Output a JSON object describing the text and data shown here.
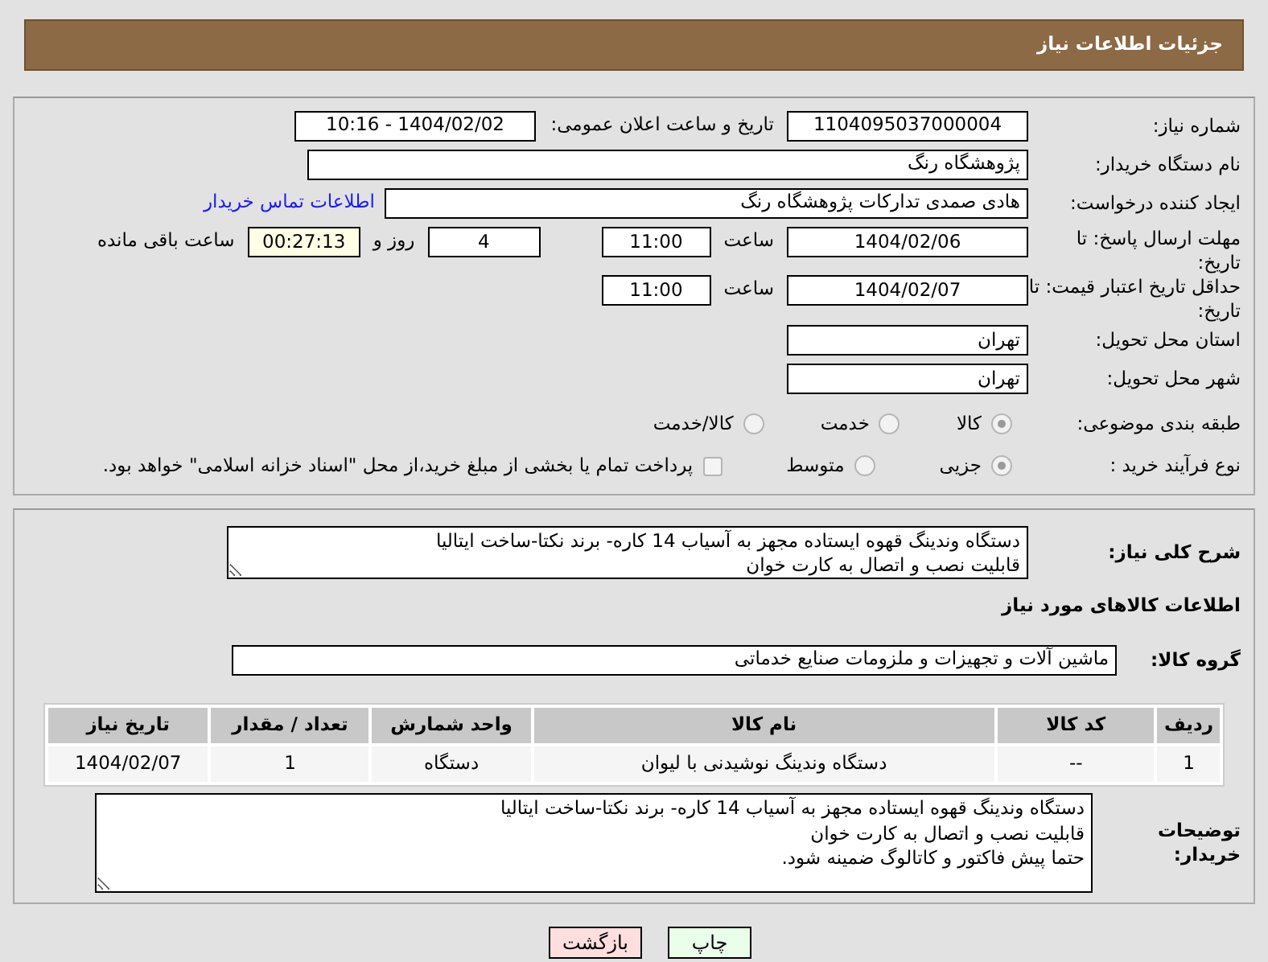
{
  "header": {
    "title": "جزئیات اطلاعات نیاز"
  },
  "need_number": {
    "label": "شماره نیاز:",
    "value": "1104095037000004"
  },
  "announce": {
    "label": "تاریخ و ساعت اعلان عمومی:",
    "value": "1404/02/02 - 10:16"
  },
  "buyer_org": {
    "label": "نام دستگاه خریدار:",
    "value": "پژوهشگاه رنگ"
  },
  "requester": {
    "label": "ایجاد کننده درخواست:",
    "value": "هادی صمدی تدارکات پژوهشگاه رنگ",
    "contact_link": "اطلاعات تماس خریدار"
  },
  "reply_deadline": {
    "label": "مهلت ارسال پاسخ: تا تاریخ:",
    "date": "1404/02/06",
    "time_label": "ساعت",
    "time": "11:00",
    "days": "4",
    "days_label": "روز و",
    "remaining": "00:27:13",
    "remaining_label": "ساعت باقی مانده"
  },
  "price_validity": {
    "label": "حداقل تاریخ اعتبار قیمت: تا تاریخ:",
    "date": "1404/02/07",
    "time_label": "ساعت",
    "time": "11:00"
  },
  "province": {
    "label": "استان محل تحویل:",
    "value": "تهران"
  },
  "city": {
    "label": "شهر محل تحویل:",
    "value": "تهران"
  },
  "category": {
    "label": "طبقه بندی موضوعی:",
    "options": [
      {
        "label": "کالا",
        "selected": true
      },
      {
        "label": "خدمت",
        "selected": false
      },
      {
        "label": "کالا/خدمت",
        "selected": false
      }
    ]
  },
  "purchase_type": {
    "label": "نوع فرآیند خرید :",
    "options": [
      {
        "label": "جزیی",
        "selected": true
      },
      {
        "label": "متوسط",
        "selected": false
      }
    ],
    "payment_note": {
      "text": "پرداخت تمام یا بخشی از مبلغ خرید،از محل \"اسناد خزانه اسلامی\" خواهد بود.",
      "checked": false
    }
  },
  "description": {
    "label": "شرح کلی نیاز:",
    "lines": [
      "دستگاه وندینگ قهوه ایستاده مجهز به آسیاب 14 کاره- برند نکتا-ساخت ایتالیا",
      "قابلیت نصب و اتصال به کارت خوان"
    ]
  },
  "goods_section_title": "اطلاعات کالاهای مورد نیاز",
  "goods_group": {
    "label": "گروه کالا:",
    "value": "ماشین آلات و تجهیزات و ملزومات صنایع خدماتی"
  },
  "table": {
    "columns": [
      "ردیف",
      "کد کالا",
      "نام کالا",
      "واحد شمارش",
      "تعداد / مقدار",
      "تاریخ نیاز"
    ],
    "rows": [
      [
        "1",
        "--",
        "دستگاه وندینگ نوشیدنی با لیوان",
        "دستگاه",
        "1",
        "1404/02/07"
      ]
    ]
  },
  "buyer_notes": {
    "label": "توضیحات خریدار:",
    "lines": [
      "دستگاه وندینگ قهوه ایستاده مجهز به آسیاب 14 کاره- برند نکتا-ساخت ایتالیا",
      "قابلیت نصب و اتصال به کارت خوان",
      "حتما پیش فاکتور و کاتالوگ ضمینه شود."
    ]
  },
  "buttons": [
    {
      "label": "چاپ",
      "kind": "print"
    },
    {
      "label": "بازگشت",
      "kind": "back"
    }
  ]
}
